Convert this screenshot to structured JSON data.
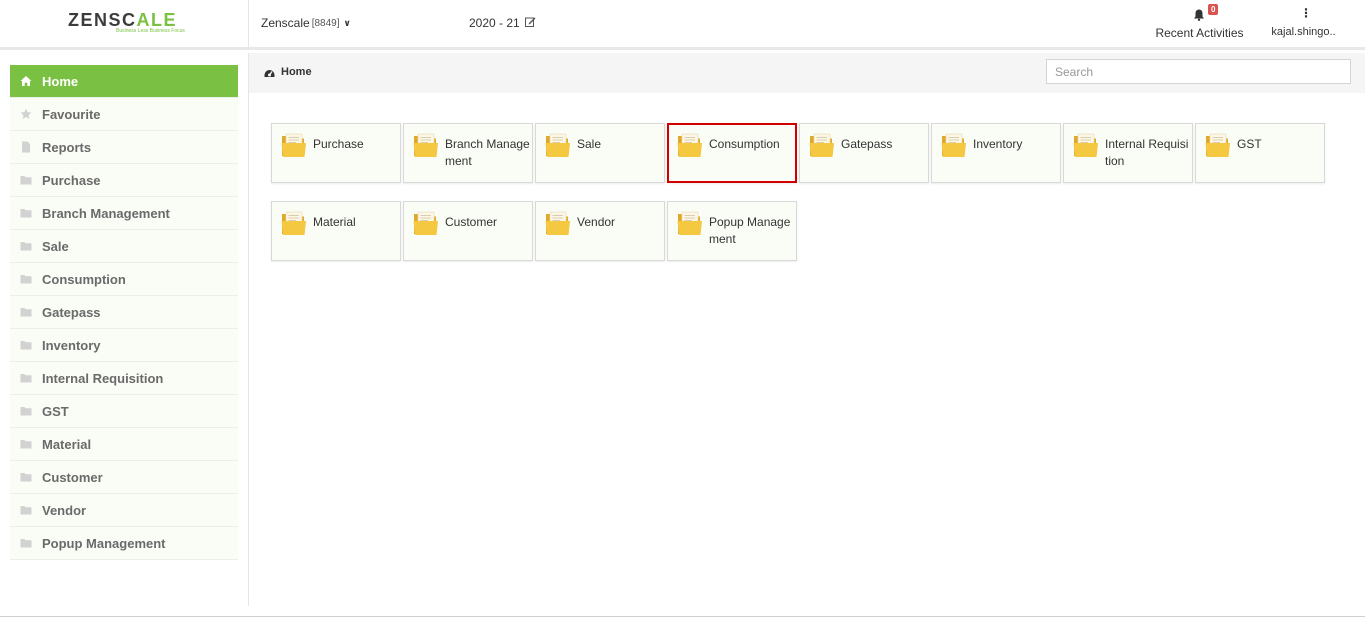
{
  "header": {
    "logo_prefix": "ZENSC",
    "logo_mid": "A",
    "logo_suffix": "LE",
    "logo_tagline": "Business Less Business Focus",
    "company_name": "Zenscale",
    "company_code": "[8849]",
    "financial_year": "2020 - 21",
    "notifications_count": "0",
    "recent_activities_label": "Recent Activities",
    "username": "kajal.shingo.."
  },
  "sidebar": {
    "items": [
      {
        "label": "Home",
        "icon": "home-icon",
        "active": true
      },
      {
        "label": "Favourite",
        "icon": "star-icon"
      },
      {
        "label": "Reports",
        "icon": "file-icon"
      },
      {
        "label": "Purchase",
        "icon": "folder-icon"
      },
      {
        "label": "Branch Management",
        "icon": "folder-icon"
      },
      {
        "label": "Sale",
        "icon": "folder-icon"
      },
      {
        "label": "Consumption",
        "icon": "folder-icon"
      },
      {
        "label": "Gatepass",
        "icon": "folder-icon"
      },
      {
        "label": "Inventory",
        "icon": "folder-icon"
      },
      {
        "label": "Internal Requisition",
        "icon": "folder-icon"
      },
      {
        "label": "GST",
        "icon": "folder-icon"
      },
      {
        "label": "Material",
        "icon": "folder-icon"
      },
      {
        "label": "Customer",
        "icon": "folder-icon"
      },
      {
        "label": "Vendor",
        "icon": "folder-icon"
      },
      {
        "label": "Popup Management",
        "icon": "folder-icon"
      }
    ]
  },
  "main": {
    "breadcrumb": "Home",
    "search_placeholder": "Search",
    "tiles": [
      {
        "label": "Purchase"
      },
      {
        "label": "Branch Management"
      },
      {
        "label": "Sale"
      },
      {
        "label": "Consumption",
        "selected": true
      },
      {
        "label": "Gatepass"
      },
      {
        "label": "Inventory"
      },
      {
        "label": "Internal Requisition"
      },
      {
        "label": "GST"
      },
      {
        "label": "Material"
      },
      {
        "label": "Customer"
      },
      {
        "label": "Vendor"
      },
      {
        "label": "Popup Management"
      }
    ]
  },
  "colors": {
    "accent_green": "#7ac143",
    "folder_yellow": "#f5c842",
    "selected_border": "#d40000",
    "badge_red": "#d9534f"
  }
}
